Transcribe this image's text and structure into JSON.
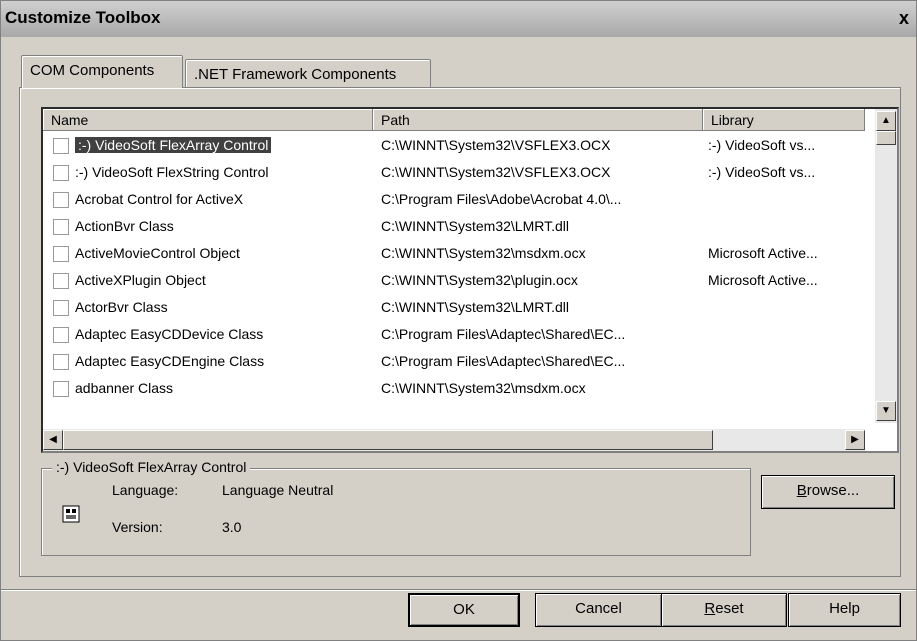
{
  "window": {
    "title": "Customize Toolbox",
    "close_glyph": "x"
  },
  "tabs": [
    {
      "label": "COM Components"
    },
    {
      "label": ".NET Framework Components"
    }
  ],
  "list": {
    "columns": [
      {
        "label": "Name"
      },
      {
        "label": "Path"
      },
      {
        "label": "Library"
      }
    ],
    "rows": [
      {
        "name": ":-) VideoSoft FlexArray Control",
        "path": "C:\\WINNT\\System32\\VSFLEX3.OCX",
        "library": ":-) VideoSoft vs..."
      },
      {
        "name": ":-) VideoSoft FlexString Control",
        "path": "C:\\WINNT\\System32\\VSFLEX3.OCX",
        "library": ":-) VideoSoft vs..."
      },
      {
        "name": "Acrobat Control for ActiveX",
        "path": "C:\\Program Files\\Adobe\\Acrobat 4.0\\...",
        "library": ""
      },
      {
        "name": "ActionBvr Class",
        "path": "C:\\WINNT\\System32\\LMRT.dll",
        "library": ""
      },
      {
        "name": "ActiveMovieControl Object",
        "path": "C:\\WINNT\\System32\\msdxm.ocx",
        "library": "Microsoft Active..."
      },
      {
        "name": "ActiveXPlugin Object",
        "path": "C:\\WINNT\\System32\\plugin.ocx",
        "library": "Microsoft Active..."
      },
      {
        "name": "ActorBvr Class",
        "path": "C:\\WINNT\\System32\\LMRT.dll",
        "library": ""
      },
      {
        "name": "Adaptec EasyCDDevice Class",
        "path": "C:\\Program Files\\Adaptec\\Shared\\EC...",
        "library": ""
      },
      {
        "name": "Adaptec EasyCDEngine Class",
        "path": "C:\\Program Files\\Adaptec\\Shared\\EC...",
        "library": ""
      },
      {
        "name": "adbanner Class",
        "path": "C:\\WINNT\\System32\\msdxm.ocx",
        "library": ""
      }
    ]
  },
  "details": {
    "group_title": ":-) VideoSoft FlexArray Control",
    "language_label": "Language:",
    "language_value": "Language Neutral",
    "version_label": "Version:",
    "version_value": "3.0",
    "icon": "component-icon"
  },
  "buttons": {
    "browse": {
      "mnemonic": "B",
      "rest": "rowse..."
    },
    "ok": "OK",
    "cancel": "Cancel",
    "reset": {
      "mnemonic": "R",
      "rest": "eset"
    },
    "help": "Help"
  }
}
